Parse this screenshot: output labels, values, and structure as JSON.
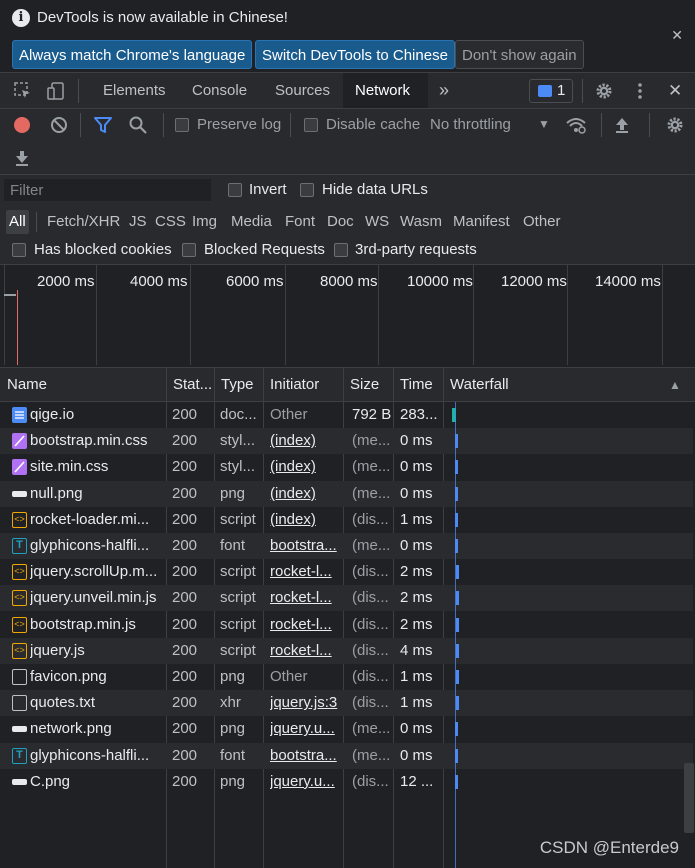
{
  "infobar": {
    "message": "DevTools is now available in Chinese!",
    "close": "✕",
    "btn_match": "Always match Chrome's language",
    "btn_switch": "Switch DevTools to Chinese",
    "btn_dont_show": "Don't show again"
  },
  "tabs": {
    "elements": "Elements",
    "console": "Console",
    "sources": "Sources",
    "network": "Network",
    "more": "»",
    "issues_count": "1",
    "close": "✕"
  },
  "toolbar": {
    "preserve_log": "Preserve log",
    "disable_cache": "Disable cache",
    "throttling": "No throttling",
    "throttling_arrow": "▼"
  },
  "filter": {
    "placeholder": "Filter",
    "invert": "Invert",
    "hide_data_urls": "Hide data URLs",
    "types": [
      "All",
      "Fetch/XHR",
      "JS",
      "CSS",
      "Img",
      "Media",
      "Font",
      "Doc",
      "WS",
      "Wasm",
      "Manifest",
      "Other"
    ],
    "has_blocked_cookies": "Has blocked cookies",
    "blocked_requests": "Blocked Requests",
    "third_party": "3rd-party requests"
  },
  "overview": {
    "ticks": [
      "2000 ms",
      "4000 ms",
      "6000 ms",
      "8000 ms",
      "10000 ms",
      "12000 ms",
      "14000 ms"
    ]
  },
  "table": {
    "headers": {
      "name": "Name",
      "status": "Stat...",
      "type": "Type",
      "initiator": "Initiator",
      "size": "Size",
      "time": "Time",
      "waterfall": "Waterfall",
      "sort": "▲"
    },
    "rows": [
      {
        "name": "qige.io",
        "status": "200",
        "type": "doc...",
        "initiator": "Other",
        "size": "792 B",
        "time": "283...",
        "icon": "document-icon"
      },
      {
        "name": "bootstrap.min.css",
        "status": "200",
        "type": "styl...",
        "initiator": "(index)",
        "size": "(me...",
        "time": "0 ms",
        "icon": "stylesheet-icon"
      },
      {
        "name": "site.min.css",
        "status": "200",
        "type": "styl...",
        "initiator": "(index)",
        "size": "(me...",
        "time": "0 ms",
        "icon": "stylesheet-icon"
      },
      {
        "name": "null.png",
        "status": "200",
        "type": "png",
        "initiator": "(index)",
        "size": "(me...",
        "time": "0 ms",
        "icon": "image-icon"
      },
      {
        "name": "rocket-loader.mi...",
        "status": "200",
        "type": "script",
        "initiator": "(index)",
        "size": "(dis...",
        "time": "1 ms",
        "icon": "script-icon"
      },
      {
        "name": "glyphicons-halfli...",
        "status": "200",
        "type": "font",
        "initiator": "bootstra...",
        "size": "(me...",
        "time": "0 ms",
        "icon": "font-icon"
      },
      {
        "name": "jquery.scrollUp.m...",
        "status": "200",
        "type": "script",
        "initiator": "rocket-l...",
        "size": "(dis...",
        "time": "2 ms",
        "icon": "script-icon"
      },
      {
        "name": "jquery.unveil.min.js",
        "status": "200",
        "type": "script",
        "initiator": "rocket-l...",
        "size": "(dis...",
        "time": "2 ms",
        "icon": "script-icon"
      },
      {
        "name": "bootstrap.min.js",
        "status": "200",
        "type": "script",
        "initiator": "rocket-l...",
        "size": "(dis...",
        "time": "2 ms",
        "icon": "script-icon"
      },
      {
        "name": "jquery.js",
        "status": "200",
        "type": "script",
        "initiator": "rocket-l...",
        "size": "(dis...",
        "time": "4 ms",
        "icon": "script-icon"
      },
      {
        "name": "favicon.png",
        "status": "200",
        "type": "png",
        "initiator": "Other",
        "size": "(dis...",
        "time": "1 ms",
        "icon": "file-icon"
      },
      {
        "name": "quotes.txt",
        "status": "200",
        "type": "xhr",
        "initiator": "jquery.js:3",
        "size": "(dis...",
        "time": "1 ms",
        "icon": "file-icon"
      },
      {
        "name": "network.png",
        "status": "200",
        "type": "png",
        "initiator": "jquery.u...",
        "size": "(me...",
        "time": "0 ms",
        "icon": "image-icon"
      },
      {
        "name": "glyphicons-halfli...",
        "status": "200",
        "type": "font",
        "initiator": "bootstra...",
        "size": "(me...",
        "time": "0 ms",
        "icon": "font-icon"
      },
      {
        "name": "C.png",
        "status": "200",
        "type": "png",
        "initiator": "jquery.u...",
        "size": "(dis...",
        "time": "12 ...",
        "icon": "image-icon"
      }
    ]
  },
  "colors": {
    "accent": "#4c8bf5",
    "record": "#e46962",
    "doc": "#4c8bf5",
    "css": "#b071f2",
    "script": "#f2a600",
    "font": "#20a0c0"
  },
  "watermark": "CSDN @Enterde9"
}
